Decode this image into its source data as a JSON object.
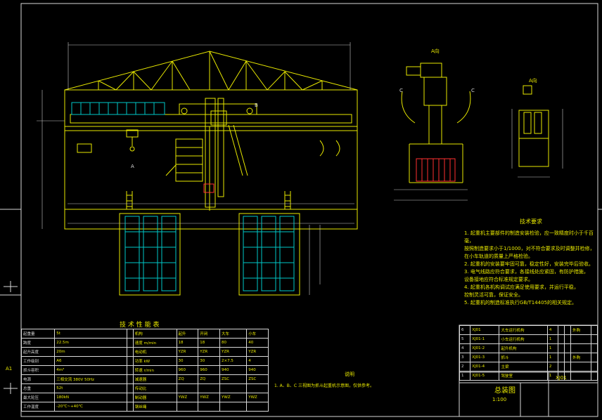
{
  "drawing": {
    "colors": {
      "background": "#000000",
      "frame": "#d8d8d8",
      "structure": "#e8e800",
      "conveyor": "#00c8c8",
      "hopper": "#ff3030",
      "dimension": "#c8c8c8"
    },
    "section_labels": {
      "top_view": "A向",
      "left_view": "A向",
      "side_view": "B向",
      "main_a": "A",
      "main_b": "B",
      "c_left": "C",
      "c_right": "C"
    },
    "table_title": "技 术 性 能 表",
    "notes_title": "技术要求",
    "notes": [
      "1. 起重机主要部件的制造安装检验，应一致精度时小于千百毫，",
      "   按照制造要求小于1/1000，对不符合要求及时调整并检修，",
      "   在小车轨道的质量上严格检验。",
      "2. 起重机的安装要牢固可靠，稳定性好，安装完毕后验收。",
      "3. 电气线路应符合要求，各接线处应紧固，有防护措施，",
      "   设备接地应符合标准规定要求。",
      "4. 起重机各机构调试应满足使用要求，并运行平稳，",
      "   控制灵活可靠，保证安全。",
      "5. 起重机的制造标准执行GB/T14405的相关规定。"
    ],
    "center_note_title": "说明",
    "center_note": "1. A、B、C 三视图为抓斗起重机示意图，仅供参考。",
    "title_block": {
      "drawing_name": "总装图",
      "code": "XJ01",
      "scale": "1:100",
      "sheet": "A1"
    },
    "bom_rows": [
      [
        "6",
        "XJ01",
        "大车运行机构",
        "4",
        "",
        "",
        "外购",
        ""
      ],
      [
        "5",
        "XJ01-1",
        "小车运行机构",
        "1",
        "",
        "",
        "",
        ""
      ],
      [
        "4",
        "XJ01-2",
        "起升机构",
        "1",
        "",
        "",
        "",
        ""
      ],
      [
        "3",
        "XJ01-3",
        "抓斗",
        "1",
        "",
        "",
        "外购",
        ""
      ],
      [
        "2",
        "XJ01-4",
        "主梁",
        "2",
        "",
        "",
        "",
        ""
      ],
      [
        "1",
        "XJ01-5",
        "驾驶室",
        "1",
        "",
        "",
        "",
        ""
      ]
    ],
    "tech_table": {
      "rows": [
        [
          "起重量",
          "5t",
          "",
          "机构",
          "起升",
          "开闭",
          "大车",
          "小车"
        ],
        [
          "跨度",
          "22.5m",
          "",
          "速度 m/min",
          "18",
          "18",
          "80",
          "40"
        ],
        [
          "起升高度",
          "20m",
          "",
          "电动机",
          "YZR",
          "YZR",
          "YZR",
          "YZR"
        ],
        [
          "工作级别",
          "A6",
          "",
          "功率 kW",
          "30",
          "30",
          "2×7.5",
          "4"
        ],
        [
          "抓斗容积",
          "4m³",
          "",
          "转速 r/min",
          "960",
          "960",
          "940",
          "940"
        ],
        [
          "电源",
          "三相交流 380V 50Hz",
          "",
          "减速器",
          "ZQ",
          "ZQ",
          "ZSC",
          "ZSC"
        ],
        [
          "总重",
          "52t",
          "",
          "传动比",
          "",
          "",
          "",
          ""
        ],
        [
          "最大轮压",
          "180kN",
          "",
          "制动器",
          "YWZ",
          "YWZ",
          "YWZ",
          "YWZ"
        ],
        [
          "工作温度",
          "-20℃~+40℃",
          "",
          "钢丝绳",
          "",
          "",
          "",
          ""
        ]
      ]
    }
  }
}
